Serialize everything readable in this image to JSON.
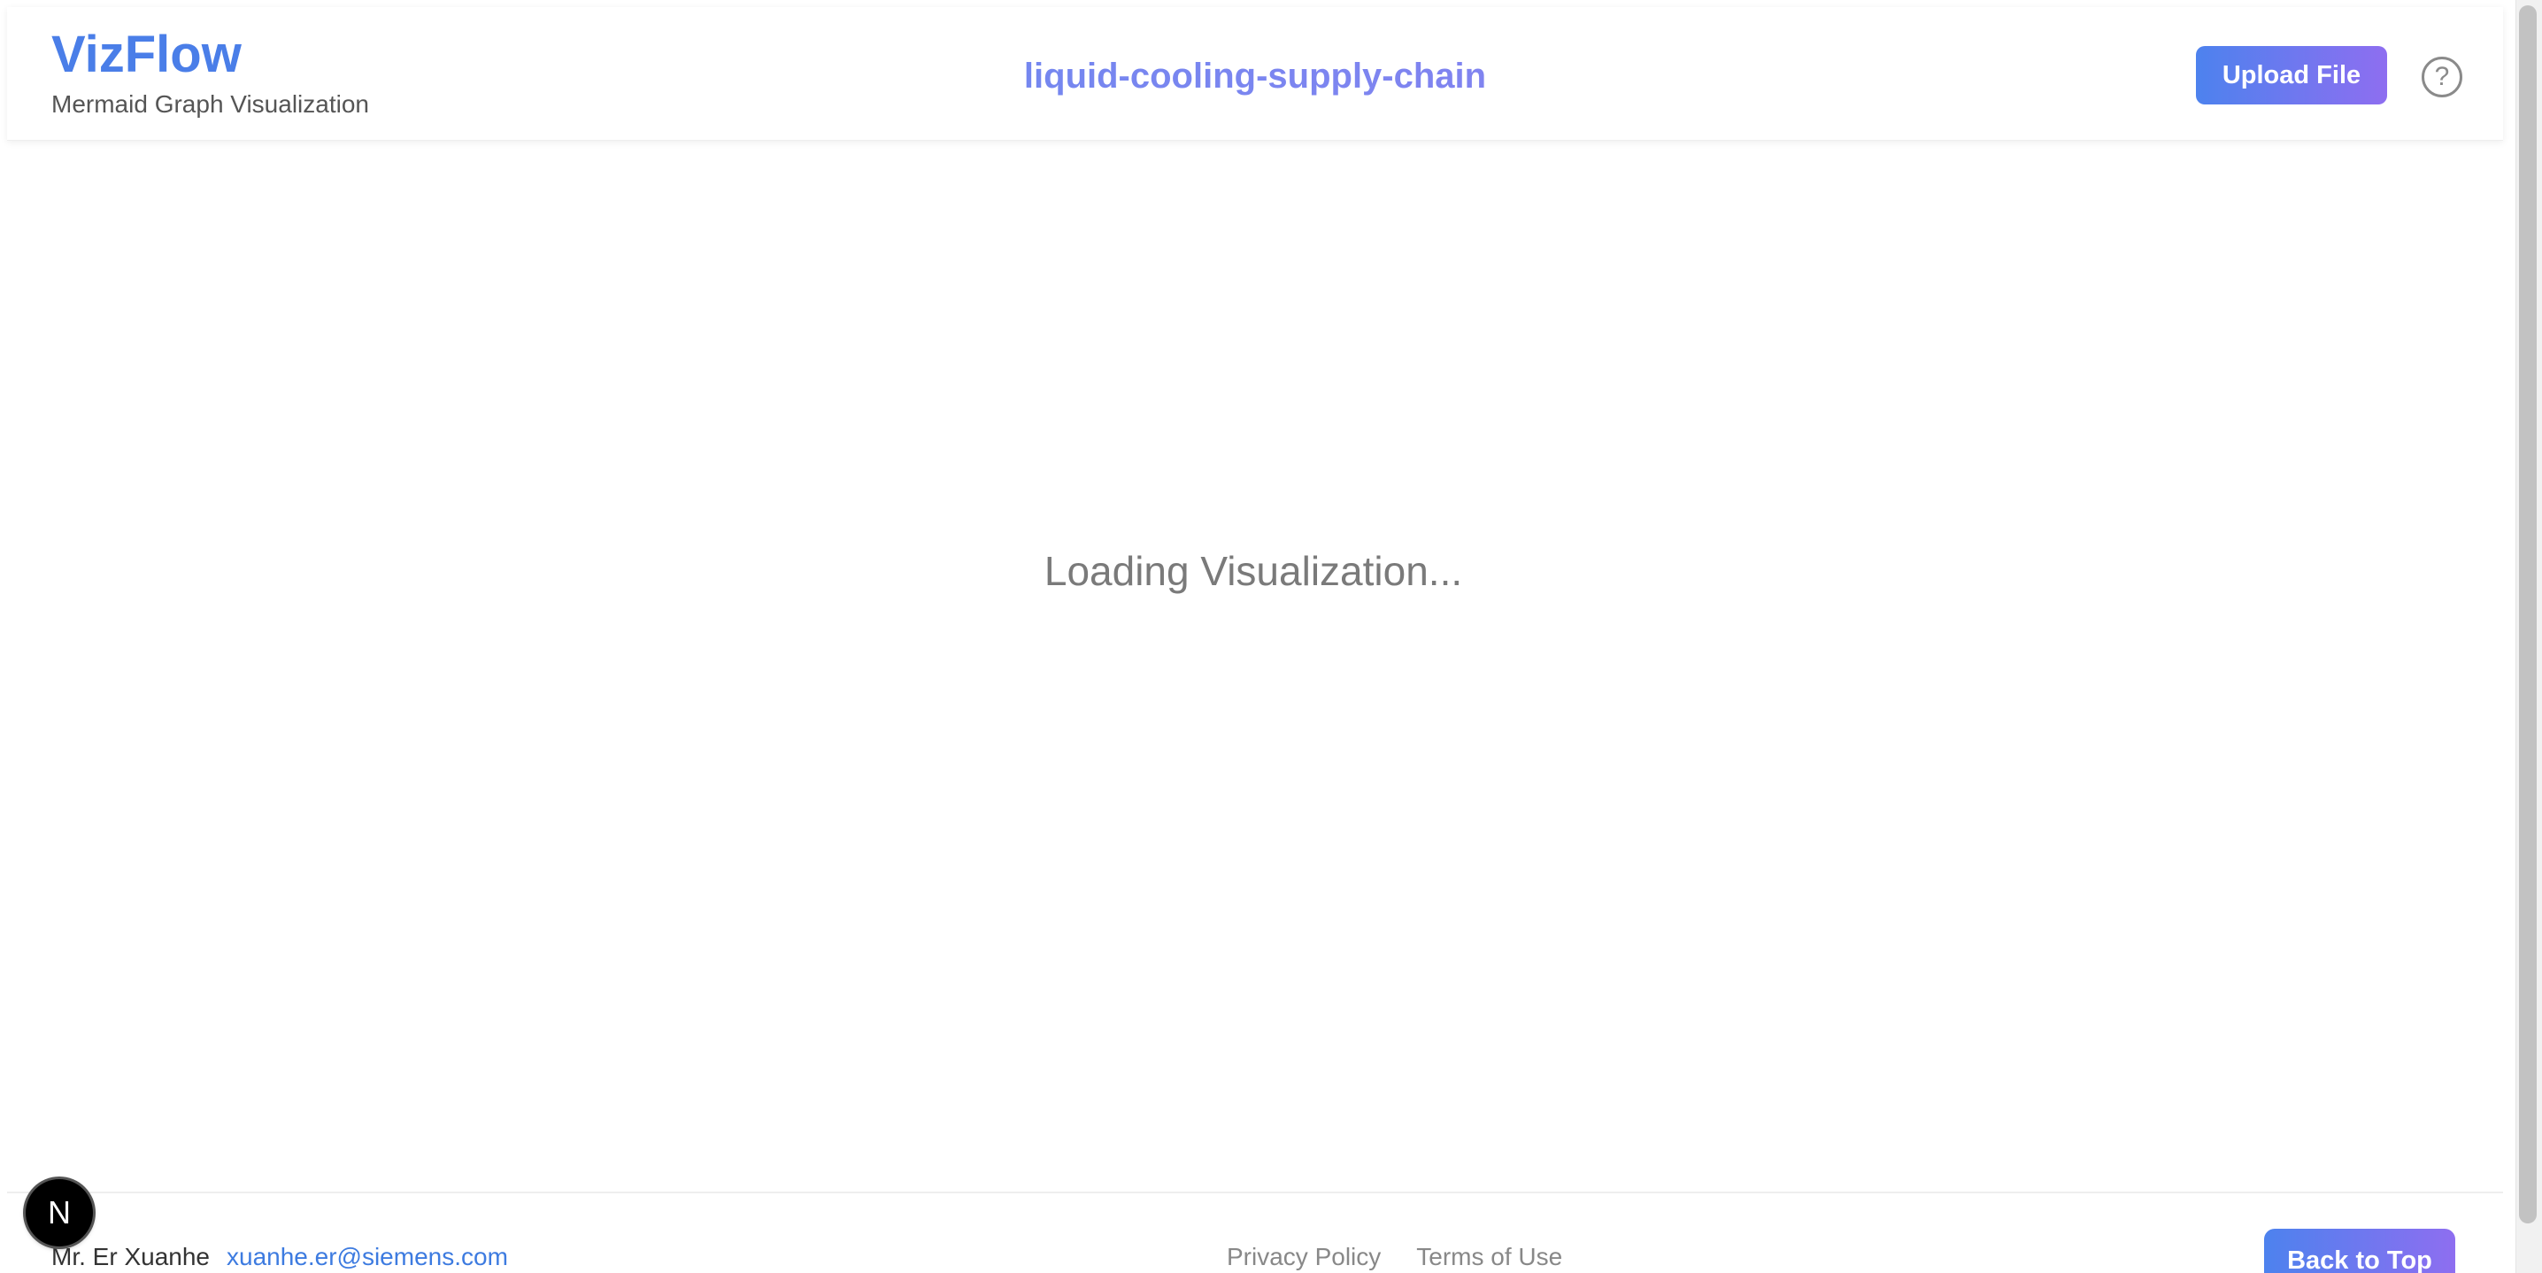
{
  "header": {
    "brand_title": "VizFlow",
    "brand_subtitle": "Mermaid Graph Visualization",
    "graph_title": "liquid-cooling-supply-chain",
    "upload_label": "Upload File",
    "help_label": "?",
    "help_icon": "help-circle-icon"
  },
  "main": {
    "loading_text": "Loading Visualization..."
  },
  "footer": {
    "author": "Mr. Er Xuanhe",
    "email": "xuanhe.er@siemens.com",
    "links": [
      "Privacy Policy",
      "Terms of Use"
    ],
    "back_to_top_label": "Back to Top"
  },
  "dev_badge": {
    "label": "N",
    "icon": "nextjs-logo-icon"
  },
  "colors": {
    "brand": "#4a7ee8",
    "gradient_start": "#4d82ee",
    "gradient_end": "#8e6ef0",
    "link": "#3d7be0",
    "muted_text": "#7a7a7a"
  }
}
